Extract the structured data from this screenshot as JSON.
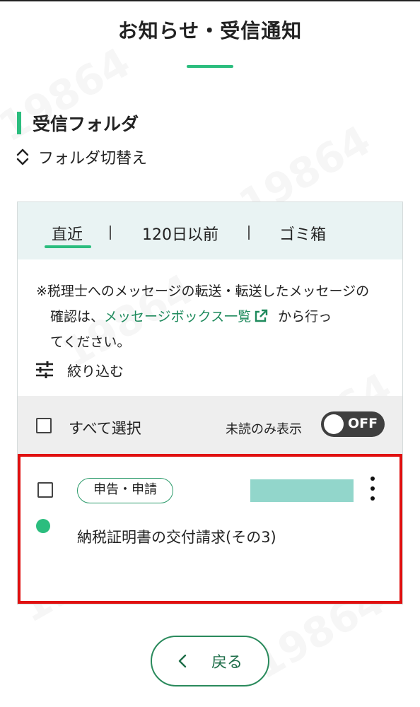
{
  "page": {
    "title": "お知らせ・受信通知"
  },
  "section": {
    "heading": "受信フォルダ",
    "folder_switch_label": "フォルダ切替え"
  },
  "tabs": [
    {
      "label": "直近",
      "active": true
    },
    {
      "label": "120日以前",
      "active": false
    },
    {
      "label": "ゴミ箱",
      "active": false
    }
  ],
  "notice": {
    "line1": "※税理士へのメッセージの転送・転送したメッセージの",
    "prefix": "確認は、",
    "link": "メッセージボックス一覧",
    "suffix": "から行っ",
    "line3": "てください。"
  },
  "filter": {
    "label": "絞り込む"
  },
  "selection": {
    "select_all_label": "すべて選択",
    "unread_only_label": "未読のみ表示",
    "toggle_state": "OFF"
  },
  "messages": [
    {
      "category": "申告・申請",
      "title": "納税証明書の交付請求(その3)",
      "unread": true
    }
  ],
  "footer": {
    "back_label": "戻る"
  },
  "colors": {
    "accent": "#2bbd7e",
    "link": "#1e8a5c",
    "highlight_border": "#e01010",
    "redacted": "#92d6cb"
  },
  "watermark": {
    "text": "19864"
  }
}
